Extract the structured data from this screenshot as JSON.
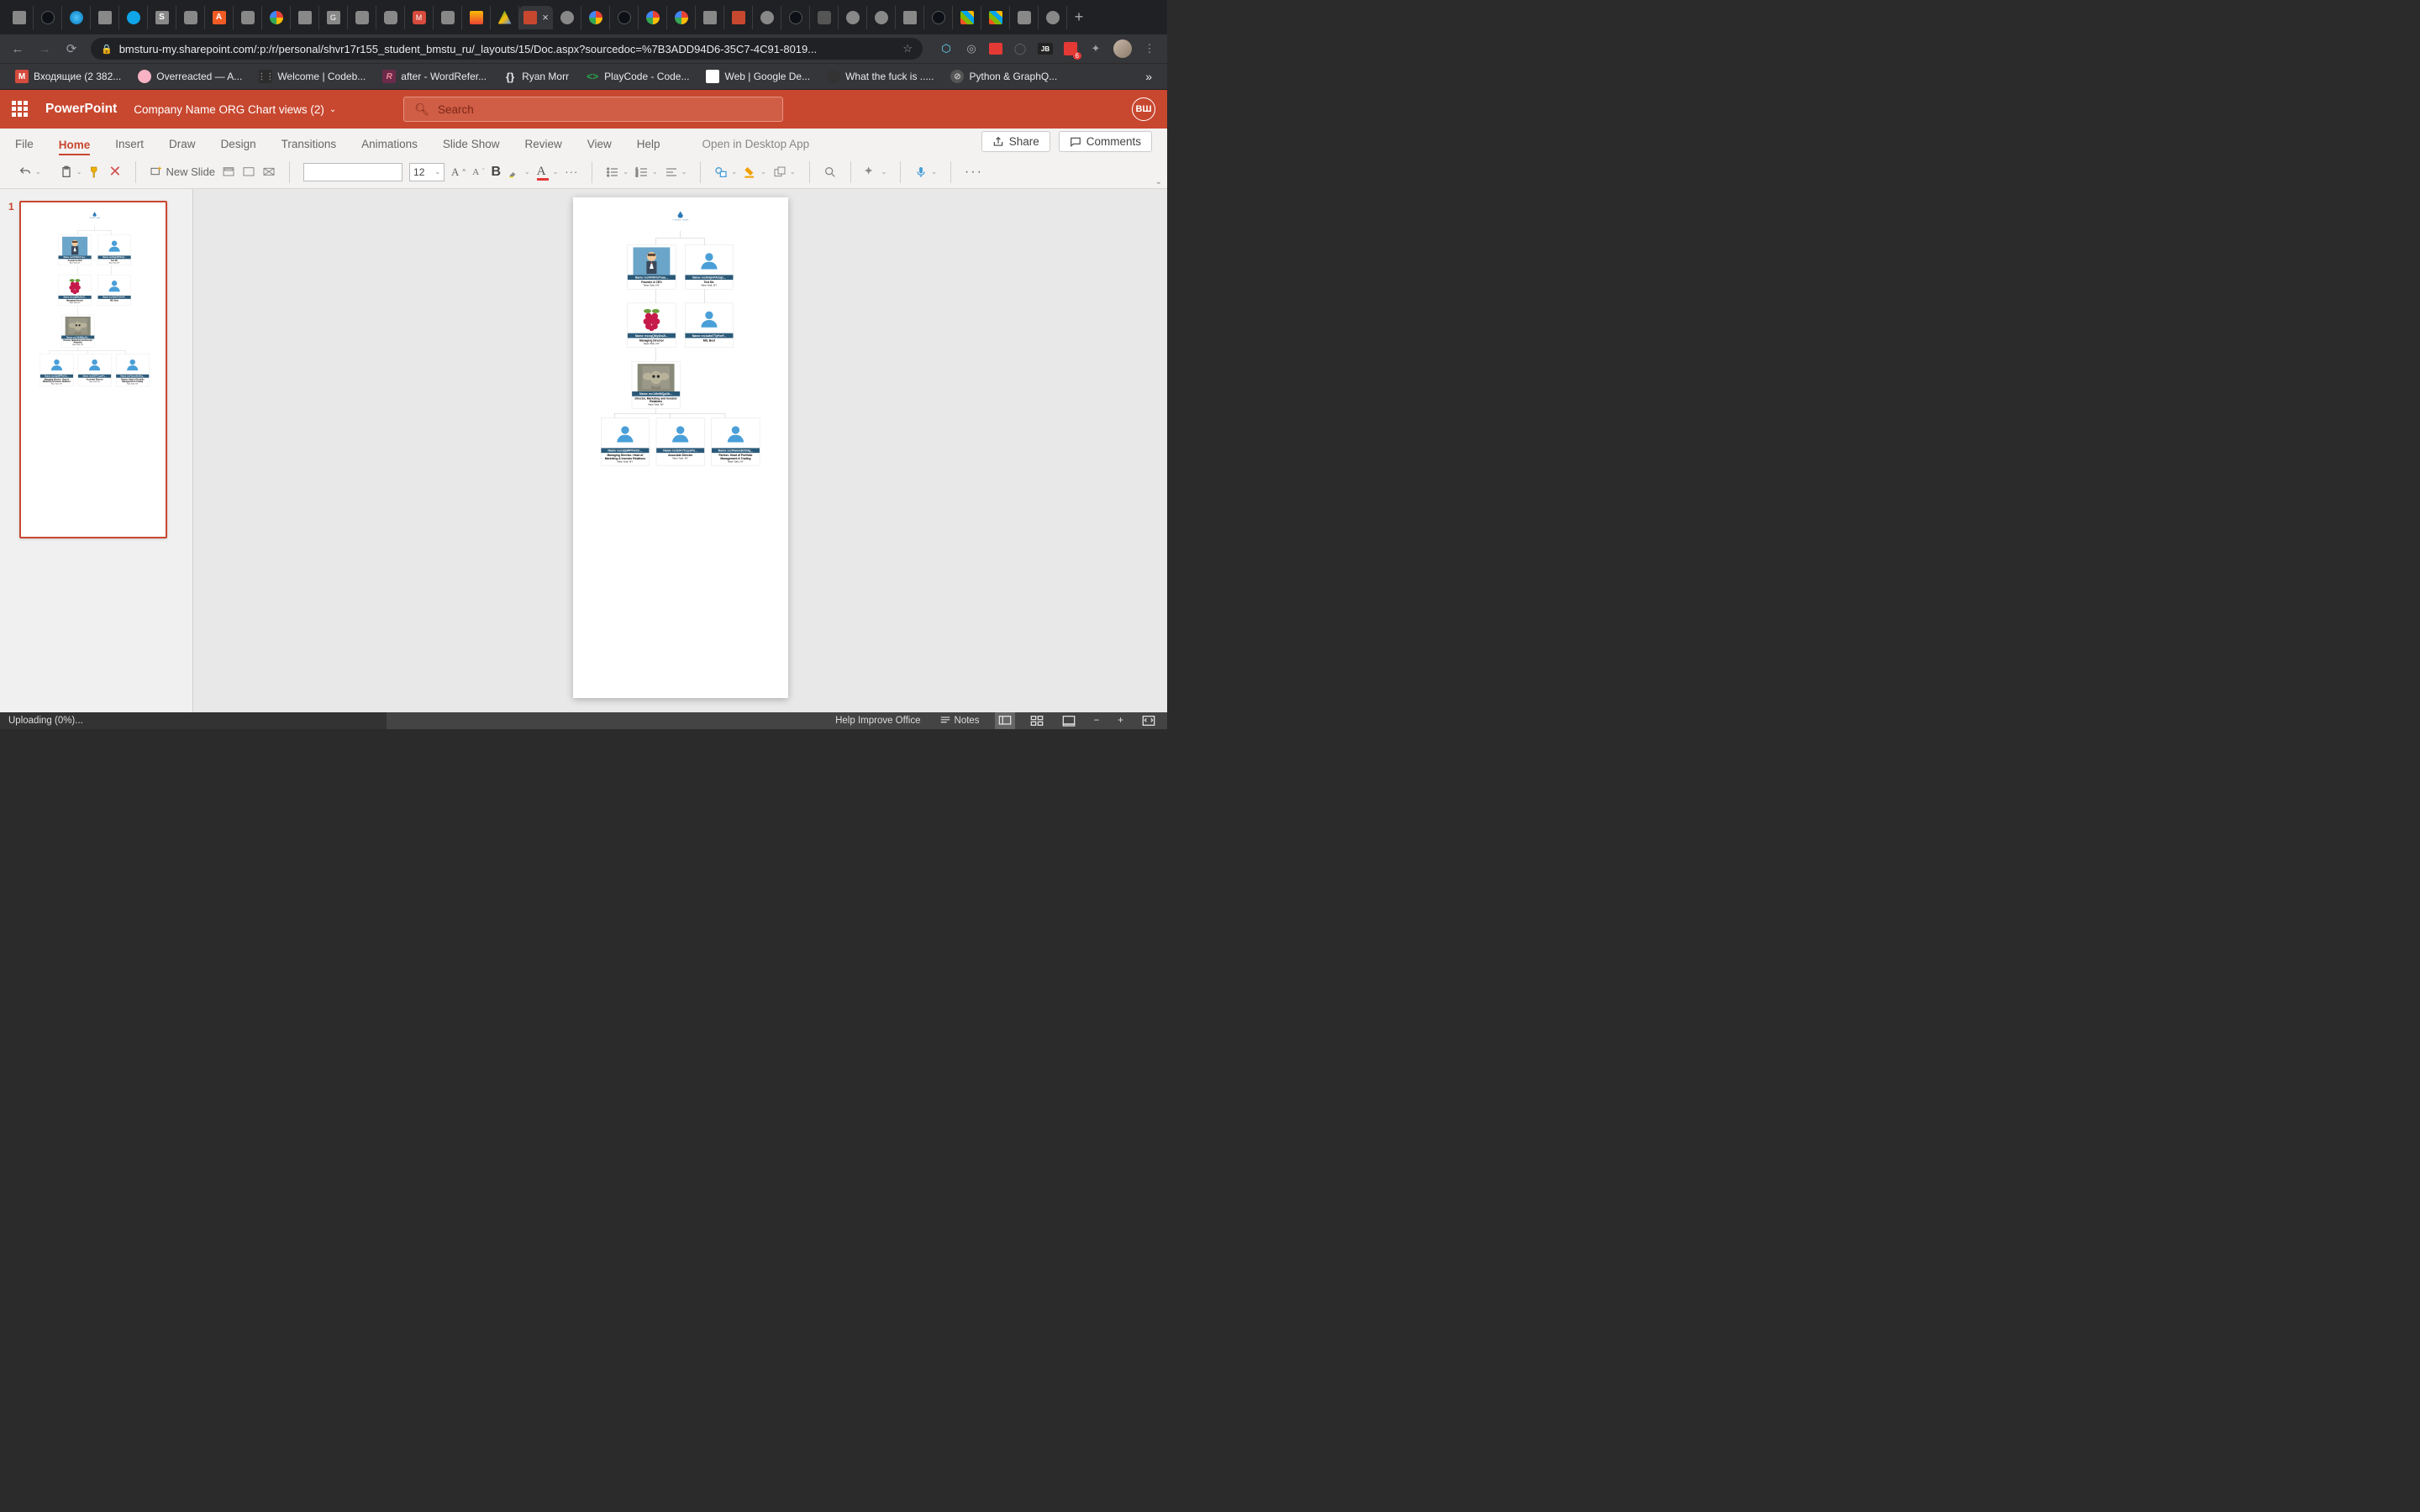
{
  "browser": {
    "url": "bmsturu-my.sharepoint.com/:p:/r/personal/shvr17r155_student_bmstu_ru/_layouts/15/Doc.aspx?sourcedoc=%7B3ADD94D6-35C7-4C91-8019...",
    "extension_badge": "6",
    "bookmarks": [
      {
        "icon": "M",
        "color": "#d54b3d",
        "label": "Входящие (2 382..."
      },
      {
        "icon": "●",
        "color": "#f7b2c4",
        "label": "Overreacted — A..."
      },
      {
        "icon": "⋮⋮⋮",
        "color": "#2c2c2c",
        "label": "Welcome | Codeb..."
      },
      {
        "icon": "R",
        "color": "#b43a6e",
        "label": "after - WordRefer..."
      },
      {
        "icon": "{}",
        "color": "#222",
        "label": "Ryan Morr"
      },
      {
        "icon": "<>",
        "color": "#2aa84a",
        "label": "PlayCode - Code..."
      },
      {
        "icon": "❖",
        "color": "#fff",
        "label": "Web  |  Google De..."
      },
      {
        "icon": "●",
        "color": "#333",
        "label": "What the fuck is ....."
      },
      {
        "icon": "⊘",
        "color": "#555",
        "label": "Python & GraphQ..."
      }
    ],
    "overflow": "»"
  },
  "ppt": {
    "app_name": "PowerPoint",
    "doc_title": "Company Name ORG Chart views (2)",
    "search_placeholder": "Search",
    "user_initials": "ВШ",
    "tabs": [
      "File",
      "Home",
      "Insert",
      "Draw",
      "Design",
      "Transitions",
      "Animations",
      "Slide Show",
      "Review",
      "View",
      "Help"
    ],
    "active_tab": "Home",
    "open_desktop": "Open in Desktop App",
    "share": "Share",
    "comments": "Comments",
    "new_slide": "New Slide",
    "font_size": "12"
  },
  "org": {
    "logo_text": "COMPANY NAME",
    "cards": {
      "r1a": {
        "name": "Name recFFWVuTvau...",
        "role": "Founder & CEO",
        "loc": "New York, NY",
        "img": "businessman"
      },
      "r1b": {
        "name": "Name rec9vipvPAZaj1...",
        "role": "Test Dir.",
        "loc": "New York, NY",
        "img": "person"
      },
      "r2a": {
        "name": "Name recxqQMyDw2I...",
        "role": "Managing Director",
        "loc": "New York, NY",
        "img": "raspberry"
      },
      "r2b": {
        "name": "Name rec4ufwTTyFmP...",
        "role": "MD, Best",
        "loc": "",
        "img": "person"
      },
      "r3a": {
        "name": "Name rec14IrtMQpUb...",
        "role": "Director, Marketing and Investor Relations",
        "loc": "New York, NY",
        "img": "yoda"
      },
      "r4a": {
        "name": "Name recn3pWPPwClr...",
        "role": "Managing Director- Head of Marketing & Investor Relations",
        "loc": "New York, NY",
        "img": "person"
      },
      "r4b": {
        "name": "Name rec8JK7CcpePo...",
        "role": "Associate Director",
        "loc": "New York, NY",
        "img": "person"
      },
      "r4c": {
        "name": "Name recFkwex8cOGq...",
        "role": "Partner- Head of Portfolio Management & Trading",
        "loc": "New York, NY",
        "img": "person"
      }
    }
  },
  "status": {
    "upload": "Uploading (0%)...",
    "help": "Help Improve Office",
    "notes": "Notes"
  },
  "slide_number": "1"
}
